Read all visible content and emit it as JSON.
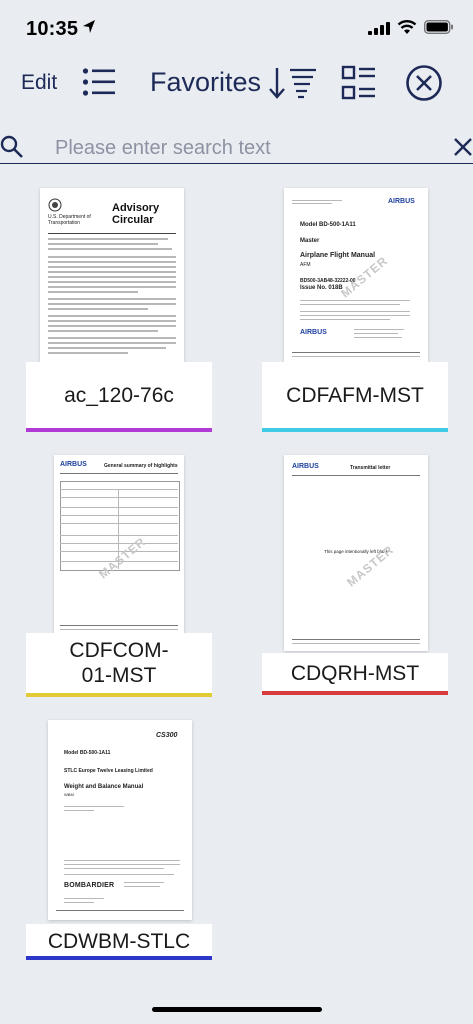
{
  "status_bar": {
    "time": "10:35"
  },
  "toolbar": {
    "edit_label": "Edit",
    "title": "Favorites"
  },
  "search": {
    "placeholder": "Please enter search text",
    "value": ""
  },
  "documents": [
    {
      "name": "ac_120-76c",
      "accent": "#b13ad6",
      "cover": {
        "heading": "Advisory Circular",
        "org": "U.S. Department of Transportation"
      }
    },
    {
      "name": "CDFAFM-MST",
      "accent": "#3ecbe6",
      "cover": {
        "brand": "AIRBUS",
        "model": "Model BD-500-1A11",
        "master": "Master",
        "title": "Airplane Flight Manual",
        "code": "AFM",
        "doc_no": "BD500-3AB48-32222-00",
        "issue": "Issue No. 018B",
        "watermark": "MASTER"
      }
    },
    {
      "name": "CDFCOM-01-MST",
      "accent": "#e2cb37",
      "cover": {
        "brand": "AIRBUS",
        "heading": "General summary of highlights",
        "watermark": "MASTER"
      }
    },
    {
      "name": "CDQRH-MST",
      "accent": "#d83b3b",
      "cover": {
        "brand": "AIRBUS",
        "heading": "Transmittal letter",
        "note": "This page intentionally left blank",
        "watermark": "MASTER"
      }
    },
    {
      "name": "CDWBM-STLC",
      "accent": "#2c36c9",
      "cover": {
        "badge": "CS300",
        "model": "Model BD-500-1A11",
        "operator": "STLC Europe Twelve Leasing Limited",
        "title": "Weight and Balance Manual",
        "code": "WBM",
        "brand": "BOMBARDIER"
      }
    }
  ]
}
